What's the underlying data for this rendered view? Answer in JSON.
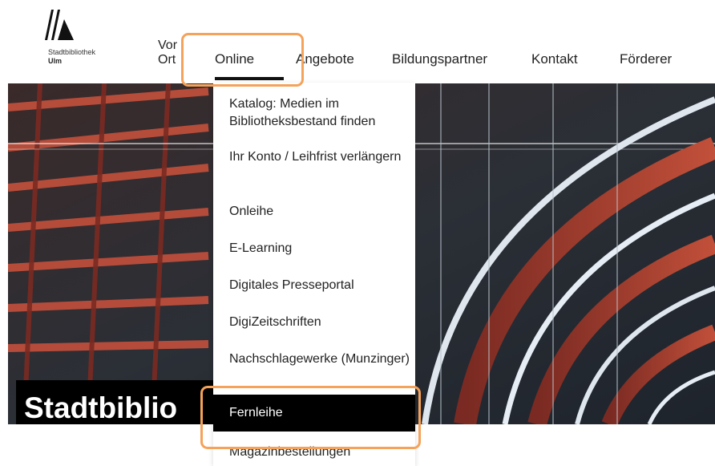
{
  "logo": {
    "line1": "Stadtbibliothek",
    "line2": "Ulm",
    "icon": "library-logo-icon"
  },
  "nav": {
    "vor": "Vor",
    "ort": "Ort",
    "online": "Online",
    "angebote": "Angebote",
    "bildungspartner": "Bildungspartner",
    "kontakt": "Kontakt",
    "foerderer": "Förderer"
  },
  "hero": {
    "title": "Stadtbiblio"
  },
  "dropdown": {
    "items": [
      {
        "label": "Katalog: Medien im Bibliotheksbestand finden"
      },
      {
        "label": "Ihr Konto / Leihfrist verlängern"
      },
      {
        "label": "Onleihe"
      },
      {
        "label": "E-Learning"
      },
      {
        "label": "Digitales Presseportal"
      },
      {
        "label": "DigiZeitschriften"
      },
      {
        "label": "Nachschlagewerke (Munzinger)"
      },
      {
        "label": "Fernleihe"
      },
      {
        "label": "Magazinbestellungen"
      }
    ],
    "active_index": 7
  },
  "colors": {
    "highlight": "#f5a25a",
    "active_bg": "#000000",
    "hero_red": "#b5412f"
  }
}
